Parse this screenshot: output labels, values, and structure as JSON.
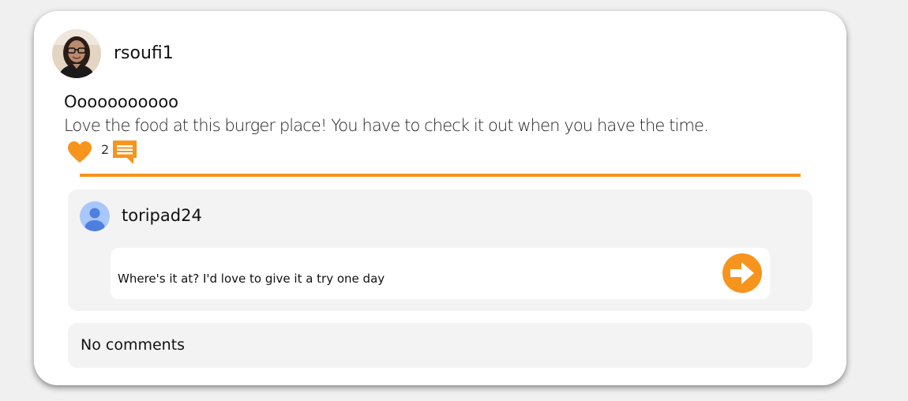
{
  "post": {
    "username": "rsoufi1",
    "title": "Ooooooooooo",
    "body": "Love the food at this burger place! You have to check it out when you have the time.",
    "like_count": "2",
    "like_icon": "heart-icon",
    "comment_icon": "comment-bubble-icon"
  },
  "comment_form": {
    "username": "toripad24",
    "value": "Where's it at? I'd love to give it a try one day",
    "send_icon": "arrow-right-icon"
  },
  "comments": {
    "empty_text": "No comments"
  },
  "colors": {
    "accent": "#f7941d",
    "panel": "#f3f3f3",
    "background": "#f0f0f0",
    "avatar_blue": "#a8c7fa",
    "avatar_blue_dark": "#4e7fe0"
  }
}
